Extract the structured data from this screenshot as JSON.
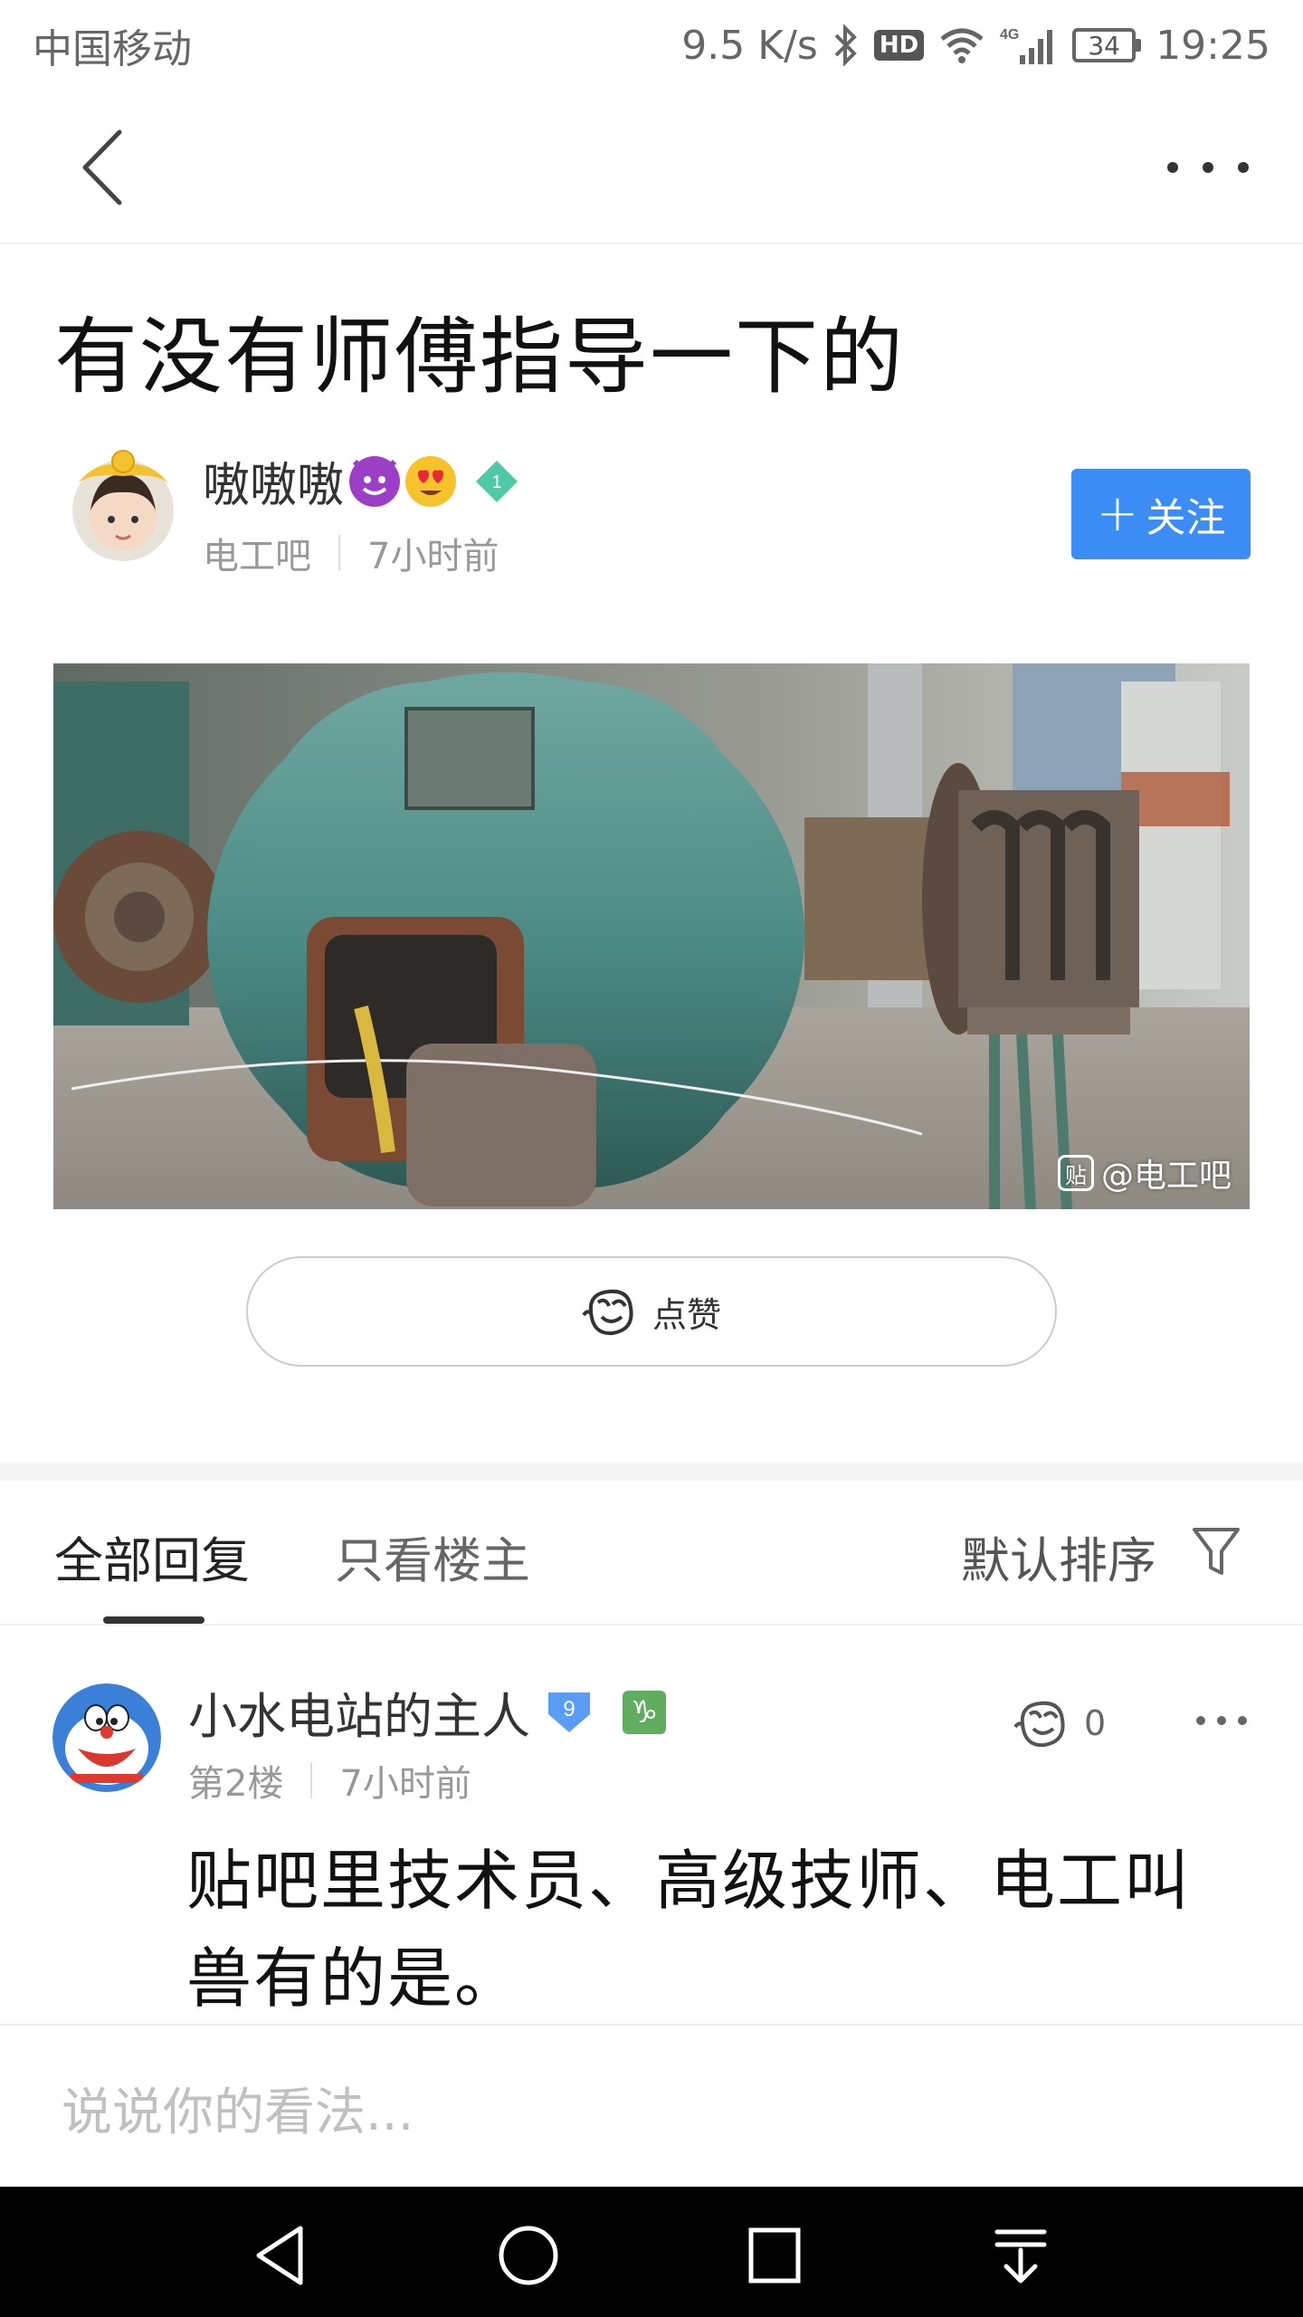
{
  "status_bar": {
    "carrier": "中国移动",
    "network_speed": "9.5 K/s",
    "hd_label": "HD",
    "signal_label": "4G",
    "battery": "34",
    "time": "19:25"
  },
  "post": {
    "title": "有没有师傅指导一下的",
    "author": {
      "name": "嗷嗷嗷",
      "level": "1",
      "forum": "电工吧",
      "time": "7小时前"
    },
    "follow_label": "关注",
    "watermark": "@电工吧",
    "watermark_icon_text": "贴",
    "like_label": "点赞"
  },
  "tabs": {
    "all_replies": "全部回复",
    "owner_only": "只看楼主",
    "sort": "默认排序"
  },
  "reply": {
    "user": "小水电站的主人",
    "level": "9",
    "zodiac": "♑",
    "floor": "第2楼",
    "time": "7小时前",
    "likes": "0",
    "text": "贴吧里技术员、高级技师、电工叫兽有的是。"
  },
  "comment": {
    "placeholder": "说说你的看法..."
  },
  "colors": {
    "accent": "#3c8cf6",
    "level_gem": "#4fc9a6",
    "level_badge": "#5b9cf5",
    "zodiac_badge": "#5fae5f"
  }
}
